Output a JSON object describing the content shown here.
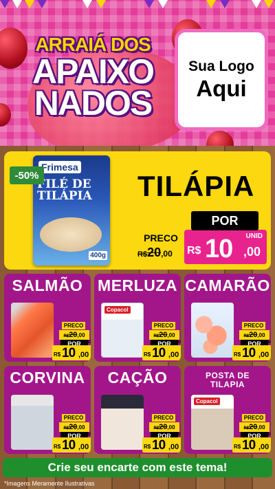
{
  "hero": {
    "title_line1": "ARRAIÁ DOS",
    "title_line2": "APAIXO",
    "title_line3": "NADOS",
    "logo_line1": "Sua Logo",
    "logo_line2": "Aqui"
  },
  "featured": {
    "discount": "-50%",
    "brand": "Frimesa",
    "package_text": "FILÉ DE TILÁPIA",
    "package_weight": "400g",
    "name": "TILÁPIA",
    "price_label": "PRECO",
    "old_currency": "R$",
    "old_value": "20",
    "old_cents": ",00",
    "por_label": "POR",
    "unit_label": "UNID",
    "new_currency": "R$",
    "new_value": "10",
    "new_cents": ",00"
  },
  "products": [
    {
      "name": "SALMÃO",
      "tag": "",
      "price_label": "PRECO",
      "old_currency": "R$",
      "old_value": "20",
      "old_cents": ",00",
      "por_label": "POR",
      "unit_label": "UNID",
      "new_currency": "R$",
      "new_value": "10",
      "new_cents": ",00"
    },
    {
      "name": "MERLUZA",
      "tag": "Copacol",
      "price_label": "PRECO",
      "old_currency": "R$",
      "old_value": "20",
      "old_cents": ",00",
      "por_label": "POR",
      "unit_label": "UNID",
      "new_currency": "R$",
      "new_value": "10",
      "new_cents": ",00"
    },
    {
      "name": "CAMARÃO",
      "tag": "",
      "price_label": "PRECO",
      "old_currency": "R$",
      "old_value": "20",
      "old_cents": ",00",
      "por_label": "POR",
      "unit_label": "UNID",
      "new_currency": "R$",
      "new_value": "10",
      "new_cents": ",00"
    },
    {
      "name": "CORVINA",
      "tag": "",
      "price_label": "PRECO",
      "old_currency": "R$",
      "old_value": "20",
      "old_cents": ",00",
      "por_label": "POR",
      "unit_label": "UNID",
      "new_currency": "R$",
      "new_value": "10",
      "new_cents": ",00"
    },
    {
      "name": "CAÇÃO",
      "tag": "",
      "price_label": "PRECO",
      "old_currency": "R$",
      "old_value": "20",
      "old_cents": ",00",
      "por_label": "POR",
      "unit_label": "UNID",
      "new_currency": "R$",
      "new_value": "10",
      "new_cents": ",00"
    },
    {
      "name": "POSTA DE TILAPIA",
      "tag": "Copacol",
      "price_label": "PRECO",
      "old_currency": "R$",
      "old_value": "20",
      "old_cents": ",00",
      "por_label": "POR",
      "unit_label": "UNID",
      "new_currency": "R$",
      "new_value": "10",
      "new_cents": ",00"
    }
  ],
  "cta_label": "Crie seu encarte com este tema!",
  "disclaimer": "*Imagens Meramente Ilustrativas",
  "colors": {
    "hero_pink": "#e43c9a",
    "yellow": "#fbd80f",
    "magenta_card": "#a3168a",
    "price_pink": "#e9238e",
    "cta_green": "#1f8f2e",
    "discount_green": "#2f8b3a"
  }
}
